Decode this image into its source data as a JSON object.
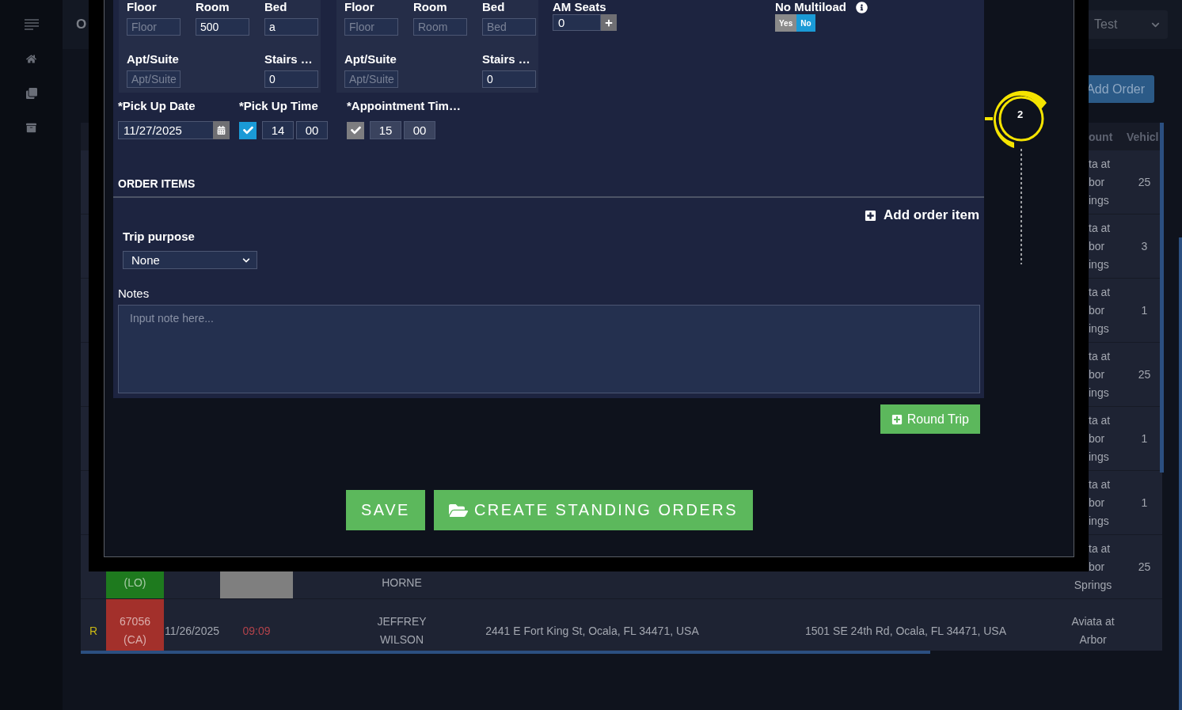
{
  "header": {
    "title": "O",
    "account_select": {
      "value": "Test"
    }
  },
  "toolbar": {
    "add_order_button": "Add Order"
  },
  "table": {
    "columns": [
      {
        "label": "ount"
      },
      {
        "label": "Vehicl"
      }
    ],
    "rows": [
      {
        "kind": "full",
        "account_lines": [
          {
            "text": "ta at",
            "kind": "cut"
          },
          {
            "text": "bor",
            "kind": "cut"
          },
          {
            "text": "ings",
            "kind": "cut"
          }
        ],
        "vehicle": "25"
      },
      {
        "kind": "full",
        "account_lines": [
          {
            "text": "ta at",
            "kind": "cut"
          },
          {
            "text": "bor",
            "kind": "cut"
          },
          {
            "text": "ings",
            "kind": "cut"
          }
        ],
        "vehicle": "3"
      },
      {
        "kind": "full",
        "account_lines": [
          {
            "text": "ta at",
            "kind": "cut"
          },
          {
            "text": "bor",
            "kind": "cut"
          },
          {
            "text": "ings",
            "kind": "cut"
          }
        ],
        "vehicle": "1"
      },
      {
        "kind": "full",
        "account_lines": [
          {
            "text": "ta at",
            "kind": "cut"
          },
          {
            "text": "bor",
            "kind": "cut"
          },
          {
            "text": "ings",
            "kind": "cut"
          }
        ],
        "vehicle": "25"
      },
      {
        "kind": "full",
        "account_lines": [
          {
            "text": "ta at",
            "kind": "cut"
          },
          {
            "text": "bor",
            "kind": "cut"
          },
          {
            "text": "ings",
            "kind": "cut"
          }
        ],
        "vehicle": "1"
      },
      {
        "kind": "full",
        "account_lines": [
          {
            "text": "ta at",
            "kind": "cut"
          },
          {
            "text": "bor",
            "kind": "cut"
          },
          {
            "text": "ings",
            "kind": "cut"
          }
        ],
        "vehicle": "1"
      },
      {
        "kind": "lower_part",
        "order_lines": [
          "(LO)"
        ],
        "color": "#1e7a1e",
        "time_cell": {
          "color": "#7f7f7f"
        },
        "name_lines": [
          "HORNE"
        ],
        "account_lines": [
          {
            "text": "ta at",
            "kind": "cut"
          },
          {
            "text": "bor",
            "kind": "cut"
          },
          {
            "text": "Springs",
            "kind": "whole"
          }
        ],
        "vehicle": "25"
      },
      {
        "kind": "full",
        "mark": "R",
        "order_lines": [
          "67056",
          "(CA)"
        ],
        "color": "#a3302b",
        "date": "11/26/2025",
        "time_cell": {
          "text": "09:09",
          "late": true
        },
        "name_lines": [
          "JEFFREY",
          "WILSON"
        ],
        "pickup": "2441 E Fort King St, Ocala, FL 34471, USA",
        "dropoff": "1501 SE 24th Rd, Ocala, FL 34471, USA",
        "account_lines": [
          {
            "text": "Aviata at",
            "kind": "whole"
          },
          {
            "text": "Arbor",
            "kind": "whole"
          }
        ]
      }
    ]
  },
  "order_modal": {
    "addresses": [
      {
        "fields": [
          {
            "label": "Floor",
            "placeholder": "Floor"
          },
          {
            "label": "Room",
            "value": "500"
          },
          {
            "label": "Bed",
            "value": "a"
          },
          {
            "label": "Apt/Suite",
            "placeholder": "Apt/Suite"
          },
          {
            "label": "Stairs …",
            "value": "0"
          }
        ]
      },
      {
        "fields": [
          {
            "label": "Floor",
            "placeholder": "Floor"
          },
          {
            "label": "Room",
            "placeholder": "Room"
          },
          {
            "label": "Bed",
            "placeholder": "Bed"
          },
          {
            "label": "Apt/Suite",
            "placeholder": "Apt/Suite"
          },
          {
            "label": "Stairs …",
            "value": "0"
          }
        ]
      }
    ],
    "am_seats": {
      "label": "AM Seats",
      "value": "0"
    },
    "no_multiload": {
      "label": "No Multiload",
      "options": [
        {
          "label": "Yes",
          "selected": false
        },
        {
          "label": "No",
          "selected": true
        }
      ]
    },
    "pickup_date": {
      "label": "*Pick Up Date",
      "value": "11/27/2025"
    },
    "times": [
      {
        "label": "*Pick Up Time",
        "checked": true,
        "disabled": false,
        "hour": "14",
        "minute": "00"
      },
      {
        "label": "*Appointment Tim…",
        "checked": true,
        "disabled": true,
        "hour": "15",
        "minute": "00"
      }
    ],
    "order_items": {
      "title": "ORDER ITEMS",
      "add_button": "Add order item"
    },
    "trip_purpose": {
      "label": "Trip purpose",
      "value": "None"
    },
    "notes": {
      "label": "Notes",
      "placeholder": "Input note here..."
    },
    "round_trip_button": "Round Trip",
    "save_button": "SAVE",
    "standing_orders_button": "CREATE STANDING ORDERS"
  },
  "step_marker": {
    "number": "2"
  }
}
